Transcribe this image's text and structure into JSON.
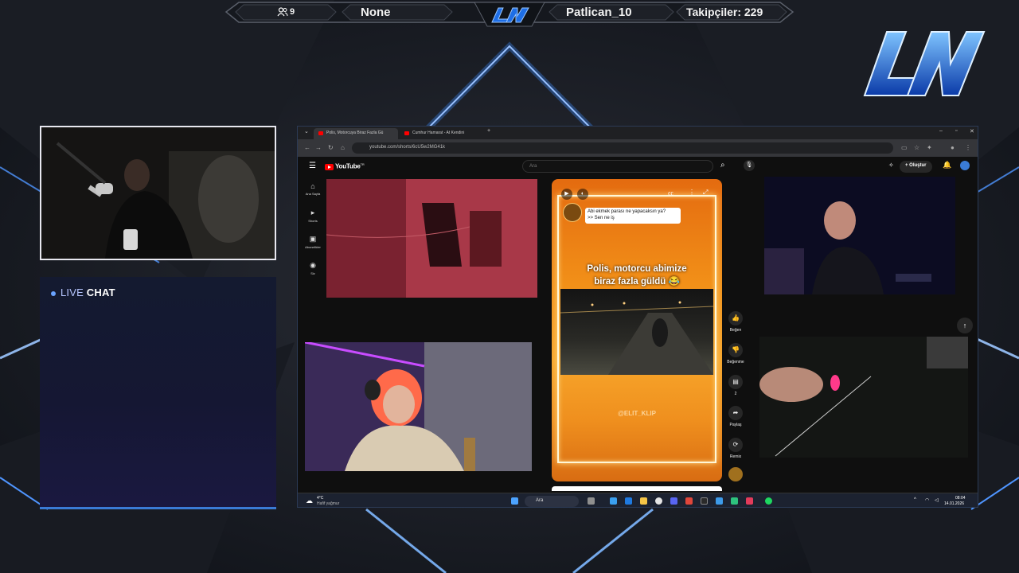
{
  "topbar": {
    "viewers": "9",
    "now_playing": "None",
    "last_follower": "Patlican_10",
    "followers_label": "Takipçiler: 229"
  },
  "chat": {
    "live": "LIVE",
    "chat": "CHAT"
  },
  "browser": {
    "tabs": [
      {
        "title": "Polis, Motorcuya Biraz Fazla Gü"
      },
      {
        "title": "Cumhur Hamarat - At Kendini"
      }
    ],
    "url": "youtube.com/shorts/6cU5w2MG41k",
    "search_placeholder": "Ara",
    "create_label": "Oluştur",
    "logo_text": "YouTube",
    "region": "TR"
  },
  "sidebar": {
    "items": [
      {
        "icon": "home-icon",
        "label": "Ana Sayfa"
      },
      {
        "icon": "shorts-icon",
        "label": "Shorts"
      },
      {
        "icon": "subscriptions-icon",
        "label": "Abonelikler"
      },
      {
        "icon": "you-icon",
        "label": "Siz"
      }
    ]
  },
  "short": {
    "caption_line1": "Abi ekmek parası ne yapacaksın ya?",
    "caption_line2": ">> Sen ne iş",
    "title_line1": "Polis, motorcu abimize",
    "title_line2": "biraz fazla güldü 😂",
    "watermark": "@ELIT_KLIP"
  },
  "actions": {
    "like": "Beğen",
    "dislike": "Beğenme",
    "comments": "2",
    "share": "Paylaş",
    "remix": "Remix"
  },
  "taskbar": {
    "weather_temp": "4°C",
    "weather_desc": "Hafif yağmur",
    "search": "Ara",
    "time": "08:04",
    "date": "14.01.2026"
  }
}
